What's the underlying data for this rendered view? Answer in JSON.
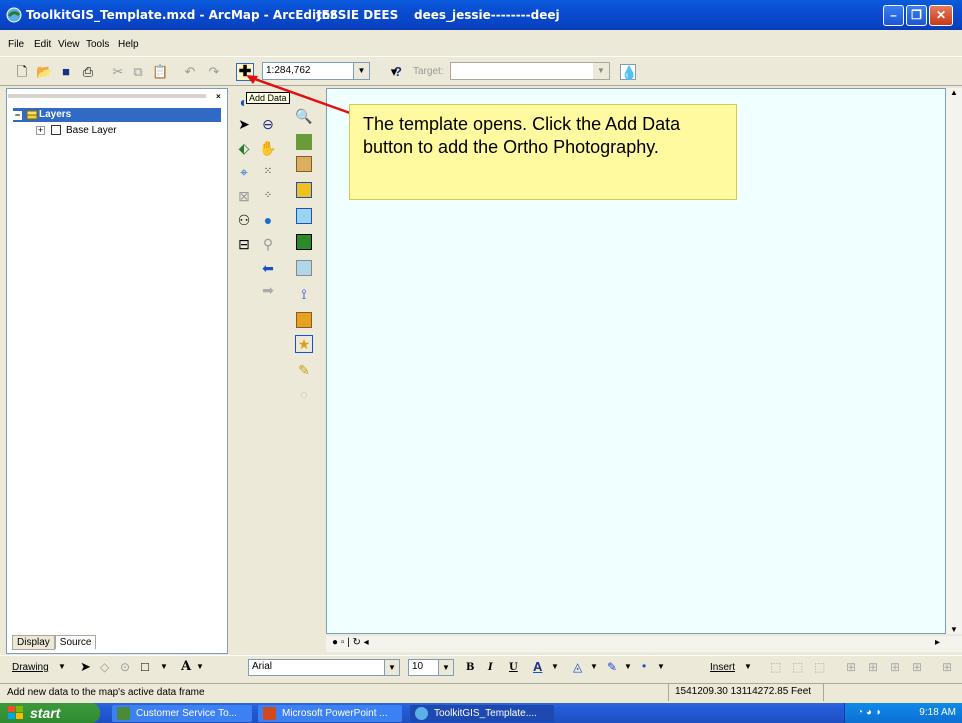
{
  "window": {
    "title": "ToolkitGIS_Template.mxd - ArcMap - ArcEditor",
    "user": "JESSIE DEES",
    "login": "dees_jessie--------deej"
  },
  "menu": [
    "File",
    "Edit",
    "View",
    "Tools",
    "Help"
  ],
  "toolbar": {
    "scale": "1:284,762",
    "target_label": "Target:",
    "tooltip": "Add Data"
  },
  "toc": {
    "root_label": "Layers",
    "layers": [
      {
        "label": "Base Layer"
      }
    ],
    "tabs": [
      "Display",
      "Source"
    ]
  },
  "callout": {
    "text": "The template opens. Click the Add Data button to add the Ortho Photography."
  },
  "drawbar": {
    "drawing_label": "Drawing",
    "font": "Arial",
    "size": "10",
    "insert_label": "Insert",
    "bold": "B",
    "italic": "I",
    "underline": "U"
  },
  "status": {
    "message": "Add new data to the map's active data frame",
    "coords": "1541209.30  13114272.85 Feet"
  },
  "taskbar": {
    "start": "start",
    "tasks": [
      "Customer Service To...",
      "Microsoft PowerPoint ...",
      "ToolkitGIS_Template...."
    ],
    "clock": "9:18 AM"
  },
  "colors": {
    "titlebar": "#0a4bd0",
    "callout_bg": "#fff9a0",
    "map_bg": "#f0ffff",
    "selection": "#316ac5",
    "arrow": "#e01010"
  }
}
